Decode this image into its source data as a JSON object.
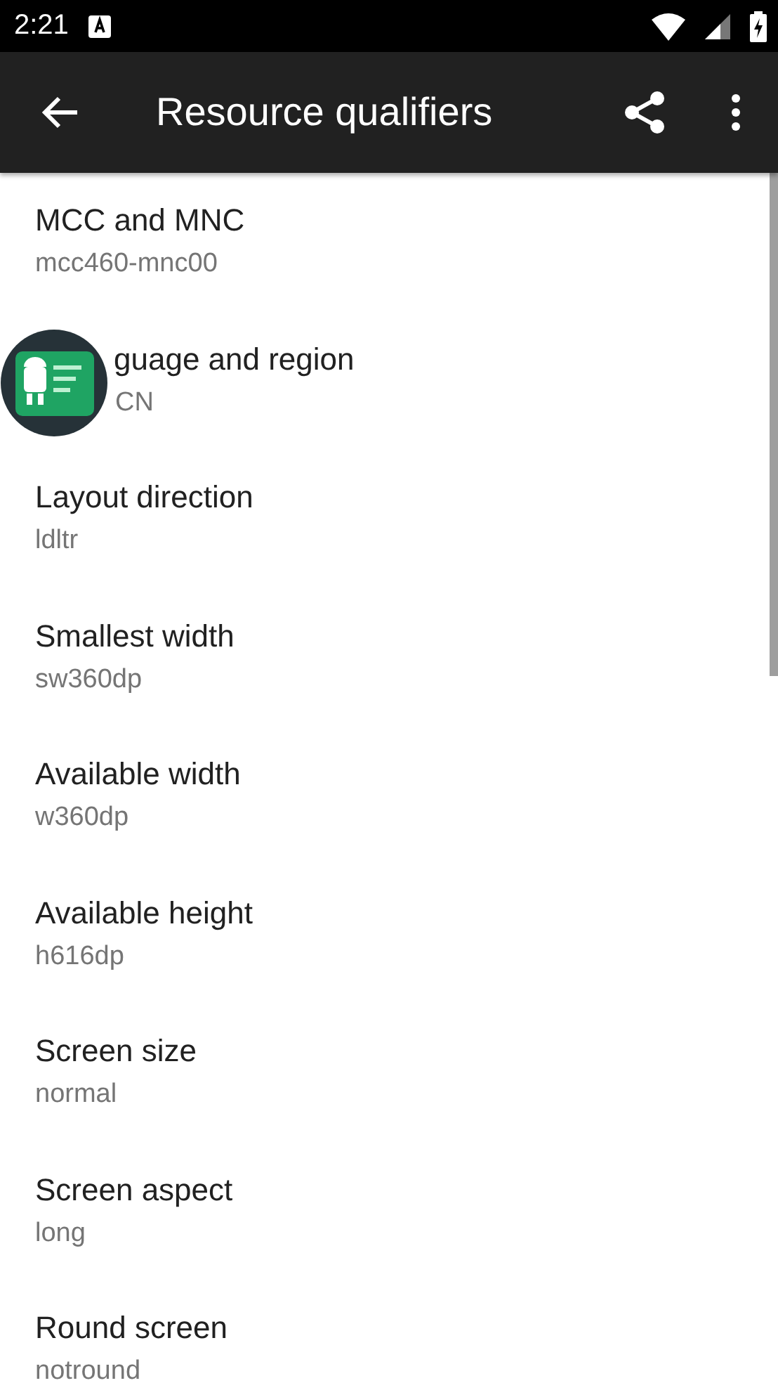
{
  "status_bar": {
    "time": "2:21"
  },
  "toolbar": {
    "title": "Resource qualifiers"
  },
  "items": [
    {
      "title": "MCC and MNC",
      "value": "mcc460-mnc00",
      "covered": false
    },
    {
      "title": "guage and region",
      "value": "CN",
      "covered": true
    },
    {
      "title": "Layout direction",
      "value": "ldltr",
      "covered": false
    },
    {
      "title": "Smallest width",
      "value": "sw360dp",
      "covered": false
    },
    {
      "title": "Available width",
      "value": "w360dp",
      "covered": false
    },
    {
      "title": "Available height",
      "value": "h616dp",
      "covered": false
    },
    {
      "title": "Screen size",
      "value": "normal",
      "covered": false
    },
    {
      "title": "Screen aspect",
      "value": "long",
      "covered": false
    },
    {
      "title": "Round screen",
      "value": "notround",
      "covered": false
    }
  ]
}
